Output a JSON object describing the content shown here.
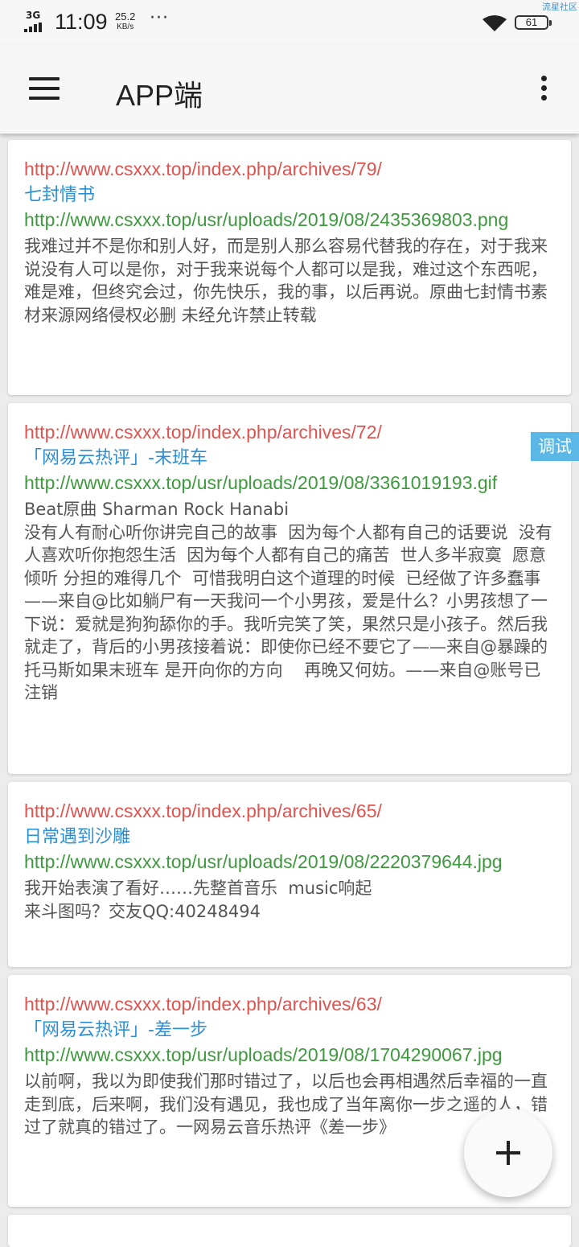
{
  "status_bar": {
    "network": "3G",
    "time": "11:09",
    "speed_value": "25.2",
    "speed_unit": "KB/s",
    "more": "···",
    "battery": "61",
    "watermark": "流星社区"
  },
  "app_bar": {
    "title": "APP端",
    "menu_icon": "hamburger-menu-icon",
    "more_icon": "more-vertical-icon"
  },
  "debug_tag": "调试",
  "posts": [
    {
      "url": "http://www.csxxx.top/index.php/archives/79/",
      "title": "七封情书",
      "image": "http://www.csxxx.top/usr/uploads/2019/08/2435369803.png",
      "description": "我难过并不是你和别人好，而是别人那么容易代替我的存在，对于我来说没有人可以是你，对于我来说每个人都可以是我，难过这个东西呢，难是难，但终究会过，你先快乐，我的事，以后再说。原曲七封情书素材来源网络侵权必删 未经允许禁止转载"
    },
    {
      "url": "http://www.csxxx.top/index.php/archives/72/",
      "title": "「网易云热评」-末班车",
      "image": "http://www.csxxx.top/usr/uploads/2019/08/3361019193.gif",
      "description": "Beat原曲 Sharman Rock Hanabi\n没有人有耐心听你讲完自己的故事  因为每个人都有自己的话要说  没有人喜欢听你抱怨生活  因为每个人都有自己的痛苦  世人多半寂寞  愿意倾听 分担的难得几个  可惜我明白这个道理的时候  已经做了许多蠢事——来自@比如躺尸有一天我问一个小男孩，爱是什么？小男孩想了一下说：爱就是狗狗舔你的手。我听完笑了笑，果然只是小孩子。然后我就走了，背后的小男孩接着说：即使你已经不要它了——来自@暴躁的托马斯如果末班车 是开向你的方向    再晚又何妨。——来自@账号已注销"
    },
    {
      "url": "http://www.csxxx.top/index.php/archives/65/",
      "title": "日常遇到沙雕",
      "image": "http://www.csxxx.top/usr/uploads/2019/08/2220379644.jpg",
      "description": "我开始表演了看好……先整首音乐  music响起\n来斗图吗？交友QQ:40248494"
    },
    {
      "url": "http://www.csxxx.top/index.php/archives/63/",
      "title": "「网易云热评」-差一步",
      "image": "http://www.csxxx.top/usr/uploads/2019/08/1704290067.jpg",
      "description": "以前啊，我以为即使我们那时错过了，以后也会再相遇然后幸福的一直走到底，后来啊，我们没有遇见，我也成了当年离你一步之遥的人，错过了就真的错过了。一网易云音乐热评《差一步》"
    }
  ],
  "fab": {
    "icon": "plus-icon"
  }
}
